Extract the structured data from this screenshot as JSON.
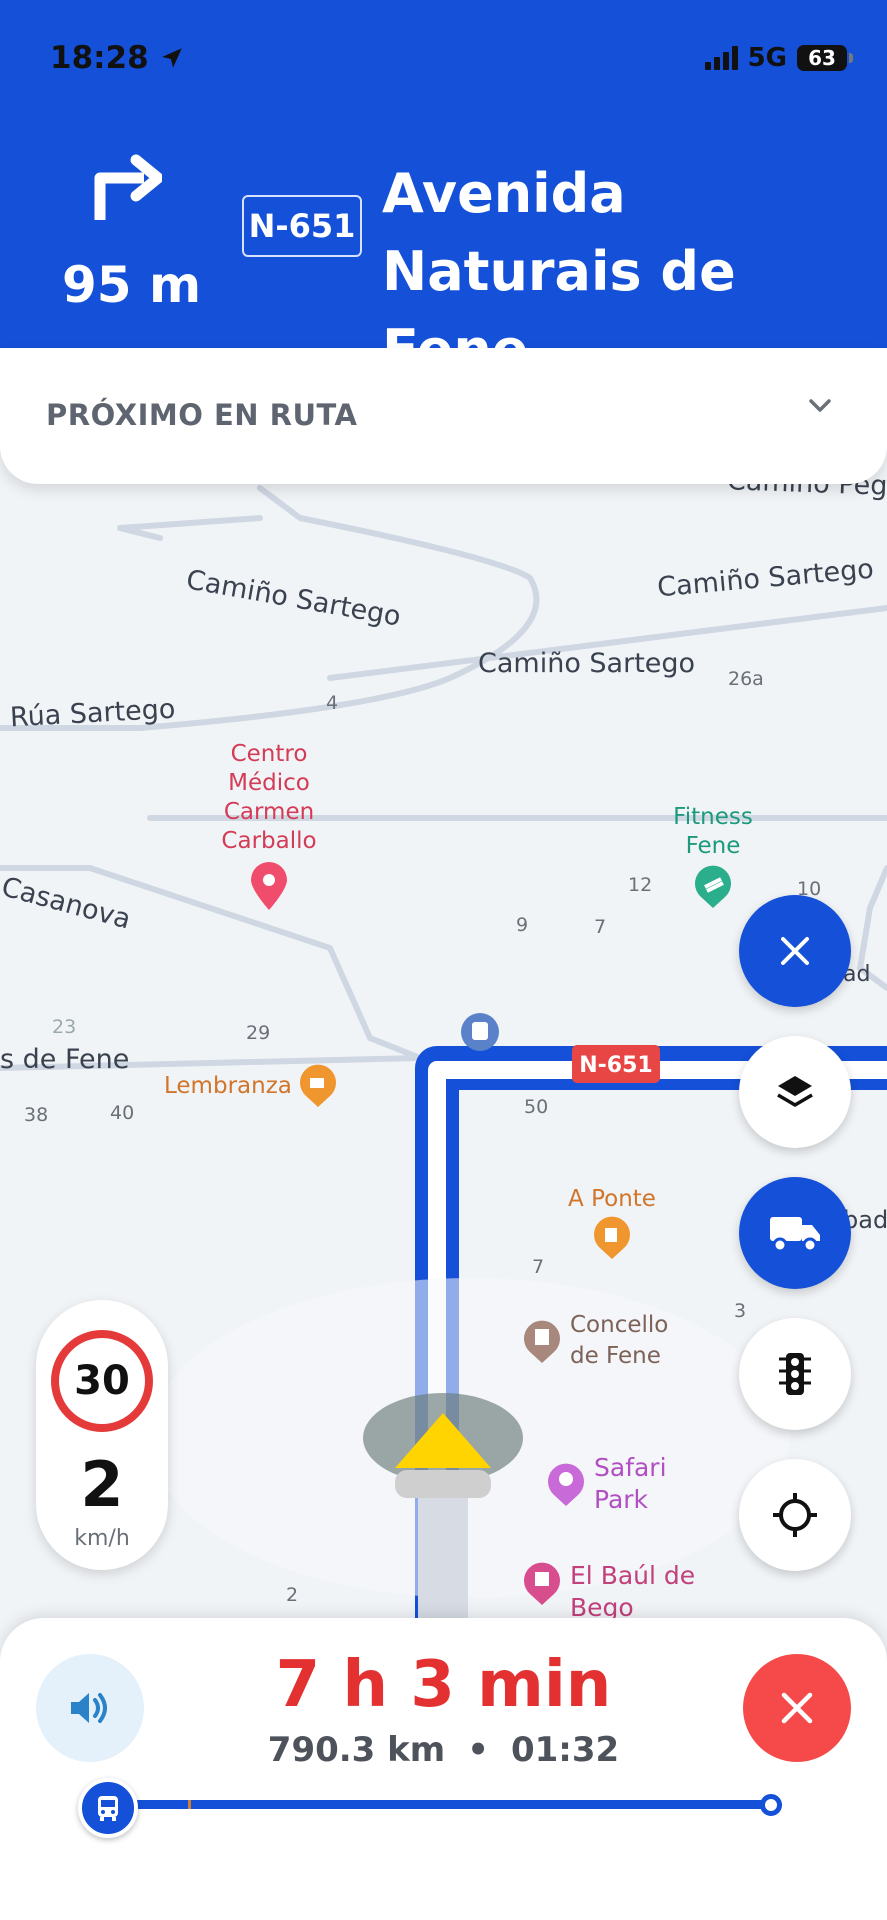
{
  "status_bar": {
    "time": "18:28",
    "network": "5G",
    "battery": "63"
  },
  "maneuver": {
    "distance": "95 m",
    "road_number": "N-651",
    "street": "Avenida Naturais de Fene",
    "icon": "turn-right-icon"
  },
  "next_on_route": {
    "label": "PRÓXIMO EN RUTA",
    "icon": "chevron-down-icon"
  },
  "map": {
    "streets": [
      "Camiño Peg",
      "Camiño Sartego",
      "Camiño Sartego",
      "Camiño Sartego",
      "Rúa Sartego",
      "Casanova",
      "s de Fene",
      "ad",
      "bad"
    ],
    "pois": [
      {
        "name": "Centro Médico Carmen Carballo",
        "icon": "map-pin-icon"
      },
      {
        "name": "Fitness Fene",
        "icon": "fitness-icon"
      },
      {
        "name": "Lembranza",
        "icon": "cafe-icon"
      },
      {
        "name": "A Ponte",
        "icon": "beer-icon"
      },
      {
        "name": "Concello de Fene",
        "icon": "building-icon"
      },
      {
        "name": "Safari Park",
        "icon": "bulb-icon"
      },
      {
        "name": "El Baúl de Bego",
        "icon": "shirt-icon"
      }
    ],
    "house_numbers": [
      "26a",
      "4",
      "12",
      "10",
      "9",
      "7",
      "23",
      "29",
      "38",
      "40",
      "50",
      "7",
      "3",
      "2"
    ],
    "road_shield": "N-651"
  },
  "speed": {
    "limit": "30",
    "current": "2",
    "unit": "km/h"
  },
  "trip": {
    "eta": "7 h 3 min",
    "distance": "790.3 km",
    "separator": "•",
    "arrival": "01:32"
  },
  "colors": {
    "primary": "#1450d8",
    "alert": "#e33131",
    "close": "#f64a4a"
  }
}
